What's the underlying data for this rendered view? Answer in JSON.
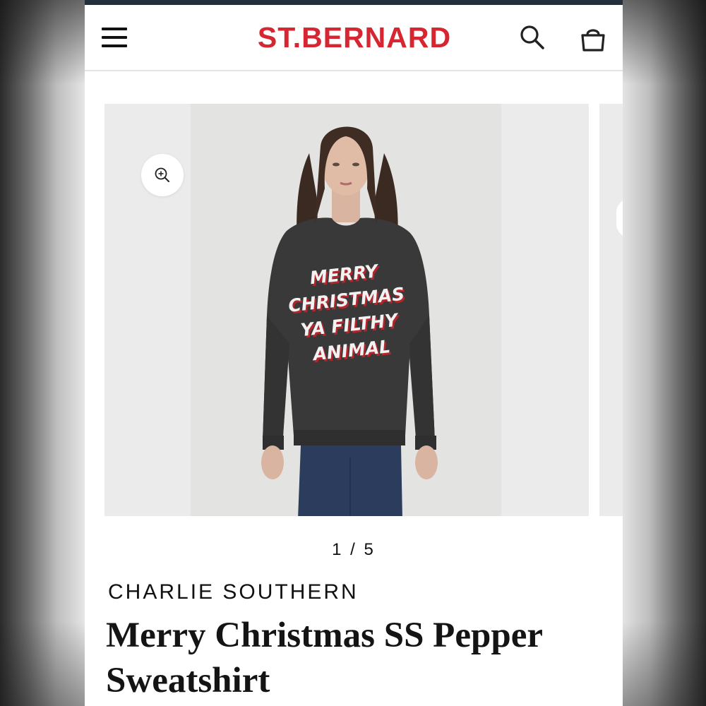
{
  "header": {
    "logo": "ST.BERNARD",
    "menu_icon": "hamburger-menu-icon",
    "search_icon": "search-icon",
    "cart_icon": "shopping-bag-icon",
    "brand_color": "#d52631"
  },
  "gallery": {
    "zoom_icon": "zoom-in-icon",
    "print_lines": [
      "MERRY",
      "CHRISTMAS",
      "YA FILTHY",
      "ANIMAL"
    ],
    "pager_current": "1",
    "pager_total": "5",
    "pager_text": "1 / 5"
  },
  "product": {
    "brand": "CHARLIE SOUTHERN",
    "title": "Merry Christmas SS Pepper Sweatshirt"
  }
}
